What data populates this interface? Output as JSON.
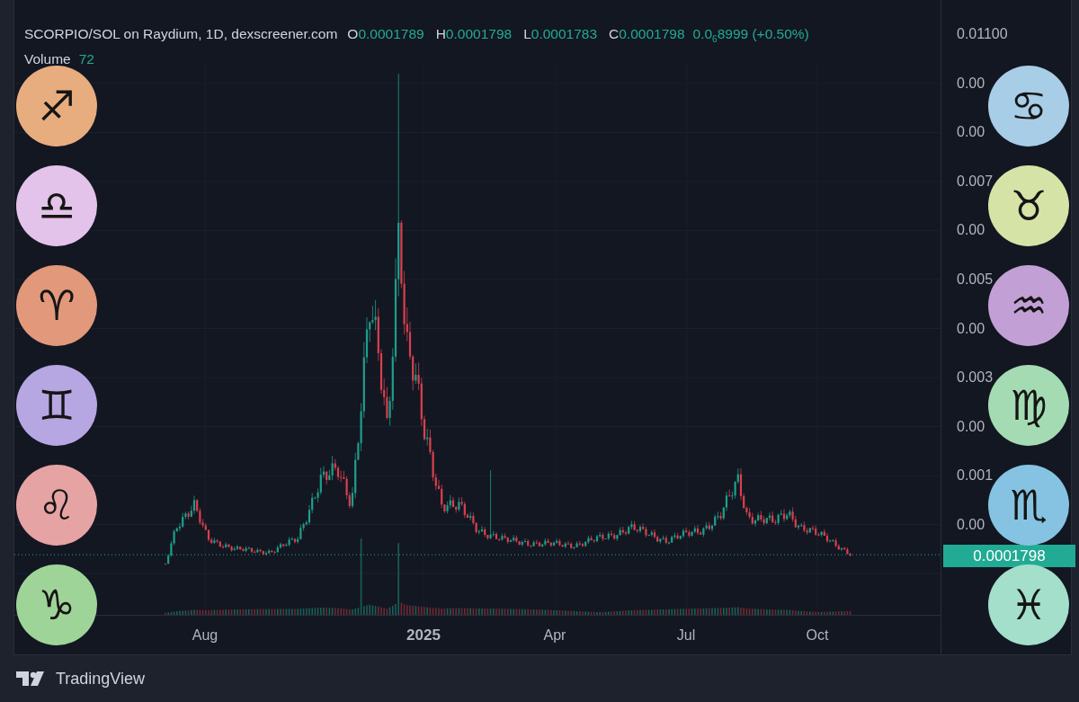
{
  "chart": {
    "title": "SCORPIO/SOL on Raydium, 1D, dexscreener.com",
    "ohlc": [
      {
        "label": "O",
        "value": "0.0001789"
      },
      {
        "label": "H",
        "value": "0.0001798"
      },
      {
        "label": "L",
        "value": "0.0001783"
      },
      {
        "label": "C",
        "value": "0.0001798"
      }
    ],
    "change": "0.0$_{6}$8999 (+0.50%)",
    "volume": {
      "label": "Volume",
      "value": "72"
    },
    "price_axis": [
      "0.01100",
      "0.00",
      "0.00",
      "0.007",
      "0.00",
      "0.005",
      "0.00",
      "0.003",
      "0.00",
      "0.001",
      "0.00"
    ],
    "last_price": "0.0001798",
    "time_axis": [
      {
        "label": "Aug",
        "bold": false
      },
      {
        "label": "2025",
        "bold": true
      },
      {
        "label": "Apr",
        "bold": false
      },
      {
        "label": "Jul",
        "bold": false
      },
      {
        "label": "Oct",
        "bold": false
      }
    ]
  },
  "left_signs": [
    {
      "sign": "♐",
      "color": "#e8ad7e"
    },
    {
      "sign": "♎",
      "color": "#e3c3ea"
    },
    {
      "sign": "♈",
      "color": "#e2987a"
    },
    {
      "sign": "♊",
      "color": "#b6a6e2"
    },
    {
      "sign": "♌",
      "color": "#e6a3a3"
    },
    {
      "sign": "♑",
      "color": "#9fd498"
    }
  ],
  "right_signs": [
    {
      "sign": "♋",
      "color": "#a8cde6"
    },
    {
      "sign": "♉",
      "color": "#d6e3a6"
    },
    {
      "sign": "♒",
      "color": "#c2a0d5"
    },
    {
      "sign": "♍",
      "color": "#a5dbb2"
    },
    {
      "sign": "♏",
      "color": "#86c3e2"
    },
    {
      "sign": "♓",
      "color": "#a3dfcb"
    }
  ],
  "footer": {
    "brand": "TradingView"
  }
}
